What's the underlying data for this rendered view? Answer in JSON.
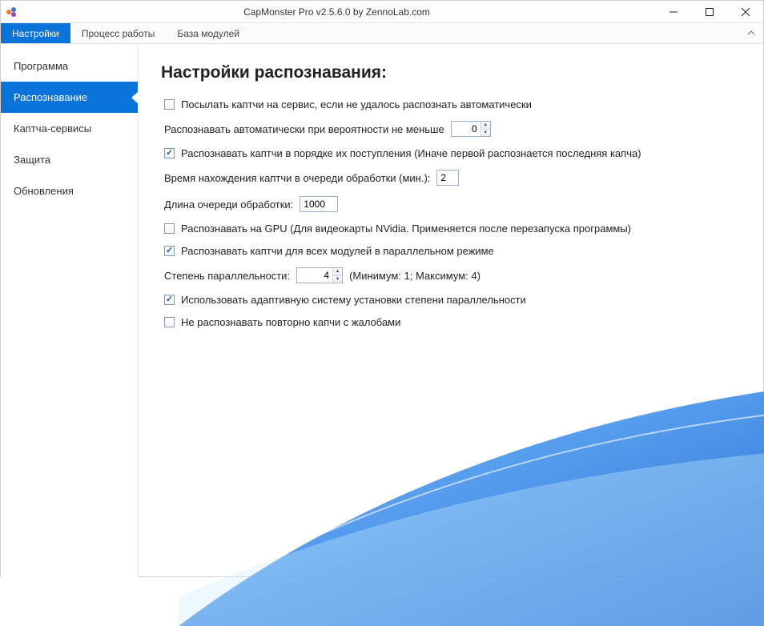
{
  "window": {
    "title": "CapMonster Pro v2.5.6.0 by ZennoLab.com"
  },
  "menu": {
    "active": 0,
    "items": [
      "Настройки",
      "Процесс работы",
      "База модулей"
    ]
  },
  "sidebar": {
    "active": 1,
    "items": [
      "Программа",
      "Распознавание",
      "Каптча-сервисы",
      "Защита",
      "Обновления"
    ]
  },
  "page": {
    "title": "Настройки распознавания:",
    "sendToServiceLabel": "Посылать каптчи на сервис, если не удалось распознать автоматически",
    "sendToServiceChecked": false,
    "autoRecognizeLabel": "Распознавать автоматически при вероятности не меньше",
    "autoRecognizeValue": "0",
    "orderFifoLabel": "Распознавать каптчи в порядке их поступления (Иначе первой распознается последняя капча)",
    "orderFifoChecked": true,
    "queueTimeoutLabel": "Время нахождения каптчи в очереди обработки (мин.):",
    "queueTimeoutValue": "2",
    "queueLengthLabel": "Длина очереди обработки:",
    "queueLengthValue": "1000",
    "gpuLabel": "Распознавать на GPU (Для видеокарты NVidia. Применяется после перезапуска программы)",
    "gpuChecked": false,
    "parallelAllLabel": "Распознавать каптчи для всех модулей в параллельном режиме",
    "parallelAllChecked": true,
    "parallelismLabel": "Степень параллельности:",
    "parallelismValue": "4",
    "parallelismHint": "(Минимум: 1; Максимум: 4)",
    "adaptiveLabel": "Использовать адаптивную систему установки степени параллельности",
    "adaptiveChecked": true,
    "noRetryLabel": "Не распознавать повторно капчи с жалобами",
    "noRetryChecked": false
  }
}
